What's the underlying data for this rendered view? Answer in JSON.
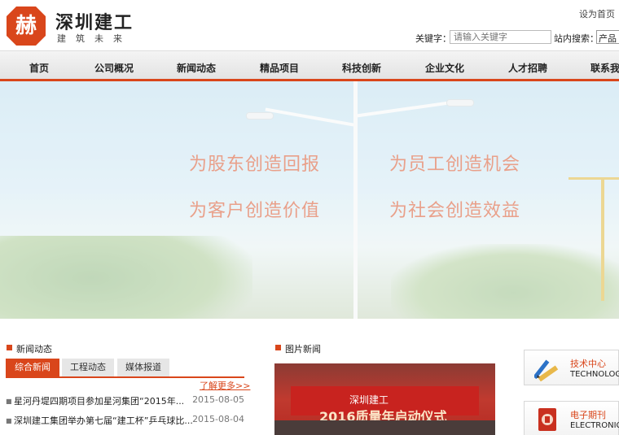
{
  "header": {
    "brand_name": "深圳建工",
    "brand_tagline": "建筑未来",
    "logo_glyph": "赫",
    "set_home": "设为首页",
    "keyword_label": "关键字：",
    "keyword_placeholder": "请输入关键字",
    "site_search_label": "站内搜索：",
    "site_search_selected": "产品"
  },
  "nav": {
    "items": [
      "首页",
      "公司概况",
      "新闻动态",
      "精品项目",
      "科技创新",
      "企业文化",
      "人才招聘",
      "联系我们"
    ]
  },
  "banner": {
    "slogans": [
      "为股东创造回报",
      "为员工创造机会",
      "为客户创造价值",
      "为社会创造效益"
    ]
  },
  "news": {
    "title": "新闻动态",
    "tabs": [
      "综合新闻",
      "工程动态",
      "媒体报道"
    ],
    "more": "了解更多>>",
    "items": [
      {
        "title": "星河丹堤四期项目参加星河集团“2015年...",
        "date": "2015-08-05"
      },
      {
        "title": "深圳建工集团举办第七届“建工杯”乒乓球比...",
        "date": "2015-08-04"
      }
    ]
  },
  "photo_news": {
    "title": "图片新闻",
    "stage_logo": "深圳建工",
    "stage_text": "2016质量年启动仪式"
  },
  "side": {
    "items": [
      {
        "title": "技术中心",
        "sub": "TECHNOLOGY",
        "icon": "pencil-ruler-icon"
      },
      {
        "title": "电子期刊",
        "sub": "ELECTRONIC",
        "icon": "magazine-icon"
      }
    ]
  },
  "colors": {
    "accent": "#d9461b",
    "slogan": "#e9a08a"
  }
}
